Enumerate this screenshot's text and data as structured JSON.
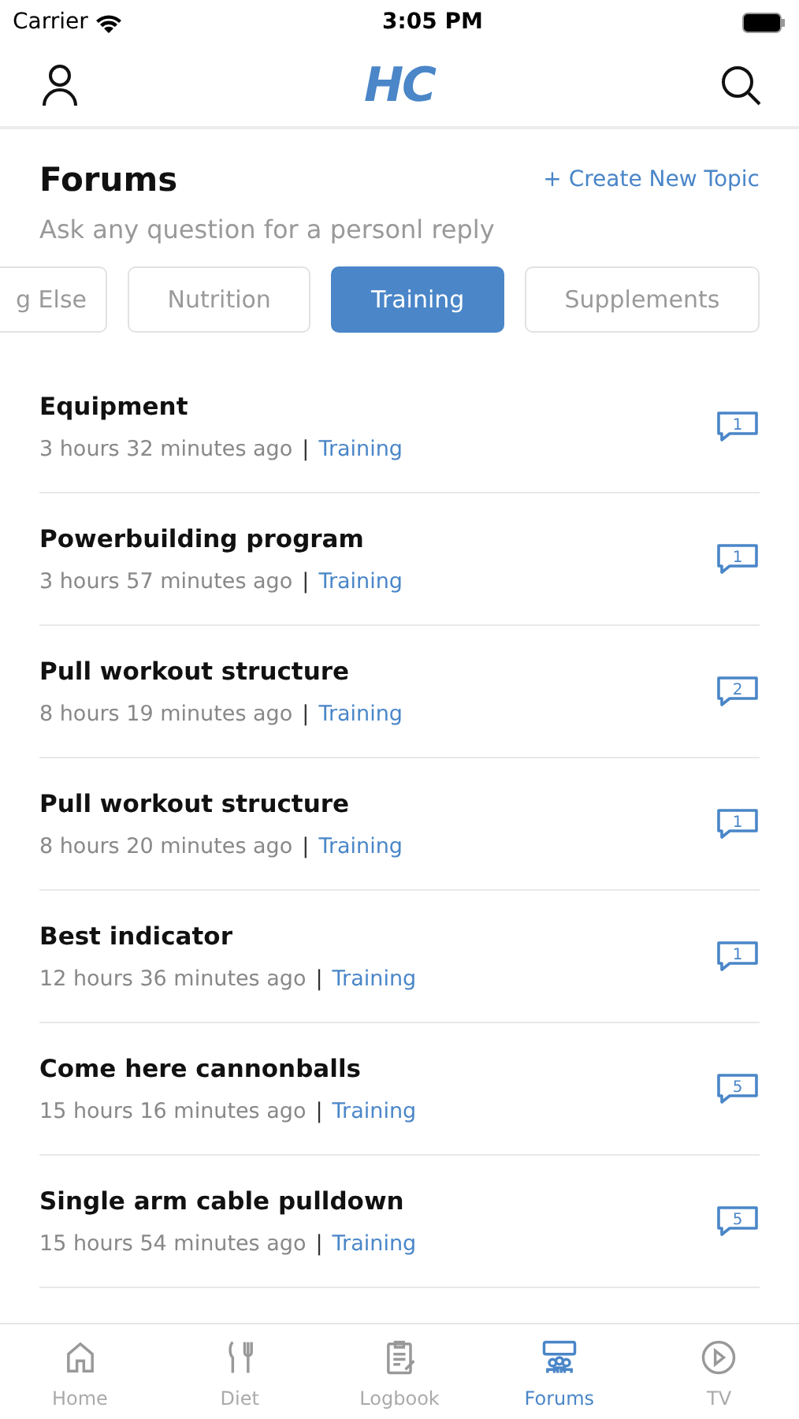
{
  "status_bar": {
    "carrier": "Carrier",
    "time": "3:05 PM"
  },
  "header": {
    "logo": "HC"
  },
  "forums": {
    "title": "Forums",
    "subtitle": "Ask any question for a personl reply",
    "create_link": "+ Create New Topic"
  },
  "categories": [
    {
      "label": "g Else",
      "selected": false,
      "cut": true
    },
    {
      "label": "Nutrition",
      "selected": false,
      "cut": false
    },
    {
      "label": "Training",
      "selected": true,
      "cut": false
    },
    {
      "label": "Supplements",
      "selected": false,
      "cut": false
    }
  ],
  "topics": [
    {
      "title": "Equipment",
      "time": "3 hours 32 minutes ago",
      "separator": "|",
      "category": "Training",
      "replies": "1"
    },
    {
      "title": "Powerbuilding program",
      "time": "3 hours 57 minutes ago",
      "separator": "|",
      "category": "Training",
      "replies": "1"
    },
    {
      "title": "Pull workout structure",
      "time": "8 hours 19 minutes ago",
      "separator": "|",
      "category": "Training",
      "replies": "2"
    },
    {
      "title": "Pull workout structure",
      "time": "8 hours 20 minutes ago",
      "separator": "|",
      "category": "Training",
      "replies": "1"
    },
    {
      "title": "Best indicator",
      "time": "12 hours 36 minutes ago",
      "separator": "|",
      "category": "Training",
      "replies": "1"
    },
    {
      "title": "Come here cannonballs",
      "time": "15 hours 16 minutes ago",
      "separator": "|",
      "category": "Training",
      "replies": "5"
    },
    {
      "title": "Single arm cable pulldown",
      "time": "15 hours 54 minutes ago",
      "separator": "|",
      "category": "Training",
      "replies": "5"
    }
  ],
  "tab_bar": [
    {
      "label": "Home",
      "kind": "home",
      "selected": false
    },
    {
      "label": "Diet",
      "kind": "diet",
      "selected": false
    },
    {
      "label": "Logbook",
      "kind": "logbook",
      "selected": false
    },
    {
      "label": "Forums",
      "kind": "forums",
      "selected": true
    },
    {
      "label": "TV",
      "kind": "tv",
      "selected": false
    }
  ]
}
